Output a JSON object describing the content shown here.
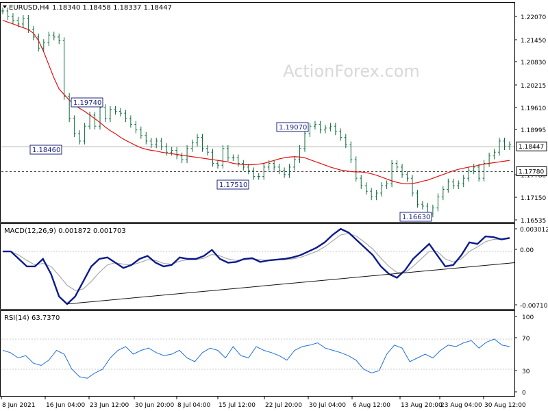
{
  "header": {
    "symbol": "EURUSD,H4",
    "ohlc": "1.18340 1.18458 1.18337 1.18447"
  },
  "watermark": "ActionForex.com",
  "colors": {
    "candle": "#0b6b3a",
    "ma": "#e01010",
    "macd": "#0a1a8c",
    "signal": "#a9a9a9",
    "rsi": "#1e6fd6",
    "trend": "#111111"
  },
  "chart_data": [
    {
      "type": "line",
      "title": "",
      "ylim": [
        1.16535,
        1.2221
      ],
      "price_ticks": [
        "1.22070",
        "1.21450",
        "1.20830",
        "1.20215",
        "1.19610",
        "1.18995",
        "1.17780",
        "1.17150",
        "1.16535"
      ],
      "x_ticks": [
        "8 Jun 2021",
        "16 Jun 04:00",
        "23 Jun 12:00",
        "30 Jun 20:00",
        "8 Jul 04:00",
        "15 Jul 12:00",
        "22 Jul 20:00",
        "30 Jul 04:00",
        "6 Aug 12:00",
        "13 Aug 20:00",
        "23 Aug 04:00",
        "30 Aug 12:00"
      ],
      "current_price": "1.18447",
      "dashed_level": "1.17780",
      "annotations": [
        "1.18460",
        "1.19740",
        "1.17510",
        "1.19070",
        "1.16630"
      ],
      "series": [
        {
          "name": "EURUSD",
          "values": [
            1.221,
            1.2195,
            1.2185,
            1.2175,
            1.219,
            1.216,
            1.214,
            1.211,
            1.2125,
            1.2145,
            1.214,
            1.213,
            1.198,
            1.192,
            1.188,
            1.186,
            1.19,
            1.193,
            1.19,
            1.195,
            1.192,
            1.1945,
            1.194,
            1.1935,
            1.192,
            1.1905,
            1.189,
            1.1875,
            1.186,
            1.185,
            1.186,
            1.1845,
            1.183,
            1.1835,
            1.182,
            1.181,
            1.184,
            1.1855,
            1.187,
            1.184,
            1.183,
            1.18,
            1.1795,
            1.184,
            1.1815,
            1.1815,
            1.18,
            1.179,
            1.178,
            1.1765,
            1.1765,
            1.179,
            1.18,
            1.179,
            1.178,
            1.177,
            1.179,
            1.181,
            1.184,
            1.188,
            1.19,
            1.1905,
            1.189,
            1.1895,
            1.19,
            1.1885,
            1.187,
            1.185,
            1.181,
            1.176,
            1.174,
            1.1725,
            1.171,
            1.172,
            1.174,
            1.1745,
            1.18,
            1.179,
            1.177,
            1.176,
            1.172,
            1.169,
            1.1685,
            1.1664,
            1.168,
            1.171,
            1.173,
            1.175,
            1.174,
            1.1745,
            1.176,
            1.178,
            1.179,
            1.176,
            1.18,
            1.182,
            1.183,
            1.186,
            1.1845,
            1.185
          ]
        },
        {
          "name": "MA",
          "values": [
            1.2185,
            1.218,
            1.2175,
            1.217,
            1.2165,
            1.216,
            1.215,
            1.213,
            1.21,
            1.2065,
            1.203,
            1.2,
            1.1985,
            1.197,
            1.1958,
            1.1948,
            1.194,
            1.193,
            1.192,
            1.191,
            1.1898,
            1.1888,
            1.188,
            1.187,
            1.1862,
            1.1855,
            1.1848,
            1.1842,
            1.1838,
            1.1835,
            1.1833,
            1.183,
            1.1828,
            1.1826,
            1.1824,
            1.1822,
            1.182,
            1.1818,
            1.1816,
            1.1814,
            1.1812,
            1.181,
            1.1808,
            1.1806,
            1.1804,
            1.18,
            1.1798,
            1.1797,
            1.1796,
            1.1797,
            1.1798,
            1.18,
            1.1804,
            1.1808,
            1.1812,
            1.1815,
            1.1817,
            1.1818,
            1.1817,
            1.1815,
            1.181,
            1.1805,
            1.18,
            1.1795,
            1.179,
            1.1786,
            1.1782,
            1.178,
            1.1778,
            1.1777,
            1.1777,
            1.1775,
            1.1772,
            1.1768,
            1.1763,
            1.1758,
            1.1753,
            1.1749,
            1.1746,
            1.1745,
            1.1746,
            1.1748,
            1.1752,
            1.1755,
            1.176,
            1.1765,
            1.177,
            1.1775,
            1.178,
            1.1784,
            1.1787,
            1.179,
            1.1792,
            1.1795,
            1.1798,
            1.18,
            1.1802,
            1.1804,
            1.1806,
            1.1808
          ]
        }
      ]
    },
    {
      "type": "line",
      "title": "MACD(12,26,9) 0.001872 0.001703",
      "ylim": [
        -0.007109,
        0.003012
      ],
      "ticks": [
        "0.003012",
        "0.00",
        "-0.007109"
      ],
      "series": [
        {
          "name": "MACD",
          "values": [
            0.0,
            0.0,
            -0.001,
            -0.002,
            -0.002,
            -0.001,
            -0.003,
            -0.006,
            -0.007,
            -0.006,
            -0.004,
            -0.002,
            -0.001,
            -0.0008,
            -0.0015,
            -0.0022,
            -0.0018,
            -0.001,
            -0.0006,
            -0.0015,
            -0.002,
            -0.0018,
            -0.0008,
            -0.001,
            -0.001,
            -0.0006,
            0.0002,
            -0.001,
            -0.0015,
            -0.0014,
            -0.001,
            -0.0009,
            -0.0014,
            -0.0012,
            -0.0011,
            -0.001,
            -0.0008,
            -0.0005,
            0.0,
            0.0005,
            0.0012,
            0.0022,
            0.003,
            0.0025,
            0.0015,
            0.0005,
            -0.0005,
            -0.002,
            -0.003,
            -0.0035,
            -0.0025,
            -0.001,
            0.0,
            0.001,
            -0.0005,
            -0.002,
            -0.0018,
            -0.0005,
            0.0012,
            0.001,
            0.002,
            0.0019,
            0.0016,
            0.0018
          ]
        },
        {
          "name": "Signal",
          "values": [
            0.0,
            0.0,
            -0.0005,
            -0.0012,
            -0.0018,
            -0.0016,
            -0.002,
            -0.0032,
            -0.0045,
            -0.0052,
            -0.005,
            -0.004,
            -0.0028,
            -0.0018,
            -0.0015,
            -0.0017,
            -0.0018,
            -0.0015,
            -0.0011,
            -0.0012,
            -0.0016,
            -0.0017,
            -0.0013,
            -0.0011,
            -0.0011,
            -0.0009,
            -0.0004,
            -0.0006,
            -0.001,
            -0.0012,
            -0.0011,
            -0.001,
            -0.0011,
            -0.0012,
            -0.0011,
            -0.0011,
            -0.001,
            -0.0008,
            -0.0004,
            0.0,
            0.0006,
            0.0014,
            0.0022,
            0.0024,
            0.002,
            0.0012,
            0.0003,
            -0.0009,
            -0.002,
            -0.0028,
            -0.0028,
            -0.002,
            -0.001,
            0.0,
            0.0,
            -0.001,
            -0.0014,
            -0.001,
            0.0,
            0.0006,
            0.0013,
            0.0016,
            0.0016,
            0.0017
          ]
        }
      ]
    },
    {
      "type": "line",
      "title": "RSI(14) 63.7370",
      "ylim": [
        0,
        100
      ],
      "ticks": [
        "100",
        "70",
        "30",
        "0"
      ],
      "series": [
        {
          "name": "RSI",
          "values": [
            55,
            52,
            45,
            48,
            38,
            35,
            42,
            55,
            50,
            30,
            20,
            18,
            25,
            30,
            45,
            55,
            60,
            50,
            55,
            58,
            52,
            48,
            50,
            55,
            45,
            40,
            52,
            58,
            55,
            45,
            60,
            48,
            45,
            60,
            55,
            52,
            48,
            42,
            55,
            60,
            62,
            65,
            58,
            55,
            52,
            48,
            42,
            30,
            25,
            28,
            50,
            62,
            58,
            40,
            45,
            50,
            45,
            55,
            62,
            60,
            65,
            68,
            58,
            66,
            70,
            62,
            60
          ]
        }
      ]
    }
  ]
}
